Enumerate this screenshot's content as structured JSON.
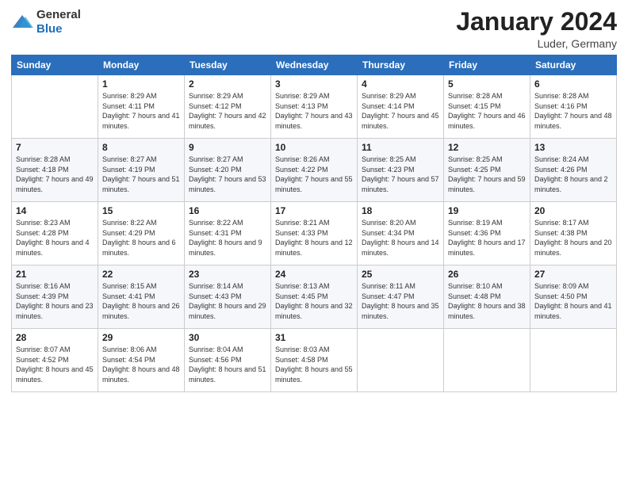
{
  "header": {
    "logo": {
      "text_general": "General",
      "text_blue": "Blue"
    },
    "title": "January 2024",
    "location": "Luder, Germany"
  },
  "days_of_week": [
    "Sunday",
    "Monday",
    "Tuesday",
    "Wednesday",
    "Thursday",
    "Friday",
    "Saturday"
  ],
  "weeks": [
    [
      {
        "day": null
      },
      {
        "day": 1,
        "sunrise": "Sunrise: 8:29 AM",
        "sunset": "Sunset: 4:11 PM",
        "daylight": "Daylight: 7 hours and 41 minutes."
      },
      {
        "day": 2,
        "sunrise": "Sunrise: 8:29 AM",
        "sunset": "Sunset: 4:12 PM",
        "daylight": "Daylight: 7 hours and 42 minutes."
      },
      {
        "day": 3,
        "sunrise": "Sunrise: 8:29 AM",
        "sunset": "Sunset: 4:13 PM",
        "daylight": "Daylight: 7 hours and 43 minutes."
      },
      {
        "day": 4,
        "sunrise": "Sunrise: 8:29 AM",
        "sunset": "Sunset: 4:14 PM",
        "daylight": "Daylight: 7 hours and 45 minutes."
      },
      {
        "day": 5,
        "sunrise": "Sunrise: 8:28 AM",
        "sunset": "Sunset: 4:15 PM",
        "daylight": "Daylight: 7 hours and 46 minutes."
      },
      {
        "day": 6,
        "sunrise": "Sunrise: 8:28 AM",
        "sunset": "Sunset: 4:16 PM",
        "daylight": "Daylight: 7 hours and 48 minutes."
      }
    ],
    [
      {
        "day": 7,
        "sunrise": "Sunrise: 8:28 AM",
        "sunset": "Sunset: 4:18 PM",
        "daylight": "Daylight: 7 hours and 49 minutes."
      },
      {
        "day": 8,
        "sunrise": "Sunrise: 8:27 AM",
        "sunset": "Sunset: 4:19 PM",
        "daylight": "Daylight: 7 hours and 51 minutes."
      },
      {
        "day": 9,
        "sunrise": "Sunrise: 8:27 AM",
        "sunset": "Sunset: 4:20 PM",
        "daylight": "Daylight: 7 hours and 53 minutes."
      },
      {
        "day": 10,
        "sunrise": "Sunrise: 8:26 AM",
        "sunset": "Sunset: 4:22 PM",
        "daylight": "Daylight: 7 hours and 55 minutes."
      },
      {
        "day": 11,
        "sunrise": "Sunrise: 8:25 AM",
        "sunset": "Sunset: 4:23 PM",
        "daylight": "Daylight: 7 hours and 57 minutes."
      },
      {
        "day": 12,
        "sunrise": "Sunrise: 8:25 AM",
        "sunset": "Sunset: 4:25 PM",
        "daylight": "Daylight: 7 hours and 59 minutes."
      },
      {
        "day": 13,
        "sunrise": "Sunrise: 8:24 AM",
        "sunset": "Sunset: 4:26 PM",
        "daylight": "Daylight: 8 hours and 2 minutes."
      }
    ],
    [
      {
        "day": 14,
        "sunrise": "Sunrise: 8:23 AM",
        "sunset": "Sunset: 4:28 PM",
        "daylight": "Daylight: 8 hours and 4 minutes."
      },
      {
        "day": 15,
        "sunrise": "Sunrise: 8:22 AM",
        "sunset": "Sunset: 4:29 PM",
        "daylight": "Daylight: 8 hours and 6 minutes."
      },
      {
        "day": 16,
        "sunrise": "Sunrise: 8:22 AM",
        "sunset": "Sunset: 4:31 PM",
        "daylight": "Daylight: 8 hours and 9 minutes."
      },
      {
        "day": 17,
        "sunrise": "Sunrise: 8:21 AM",
        "sunset": "Sunset: 4:33 PM",
        "daylight": "Daylight: 8 hours and 12 minutes."
      },
      {
        "day": 18,
        "sunrise": "Sunrise: 8:20 AM",
        "sunset": "Sunset: 4:34 PM",
        "daylight": "Daylight: 8 hours and 14 minutes."
      },
      {
        "day": 19,
        "sunrise": "Sunrise: 8:19 AM",
        "sunset": "Sunset: 4:36 PM",
        "daylight": "Daylight: 8 hours and 17 minutes."
      },
      {
        "day": 20,
        "sunrise": "Sunrise: 8:17 AM",
        "sunset": "Sunset: 4:38 PM",
        "daylight": "Daylight: 8 hours and 20 minutes."
      }
    ],
    [
      {
        "day": 21,
        "sunrise": "Sunrise: 8:16 AM",
        "sunset": "Sunset: 4:39 PM",
        "daylight": "Daylight: 8 hours and 23 minutes."
      },
      {
        "day": 22,
        "sunrise": "Sunrise: 8:15 AM",
        "sunset": "Sunset: 4:41 PM",
        "daylight": "Daylight: 8 hours and 26 minutes."
      },
      {
        "day": 23,
        "sunrise": "Sunrise: 8:14 AM",
        "sunset": "Sunset: 4:43 PM",
        "daylight": "Daylight: 8 hours and 29 minutes."
      },
      {
        "day": 24,
        "sunrise": "Sunrise: 8:13 AM",
        "sunset": "Sunset: 4:45 PM",
        "daylight": "Daylight: 8 hours and 32 minutes."
      },
      {
        "day": 25,
        "sunrise": "Sunrise: 8:11 AM",
        "sunset": "Sunset: 4:47 PM",
        "daylight": "Daylight: 8 hours and 35 minutes."
      },
      {
        "day": 26,
        "sunrise": "Sunrise: 8:10 AM",
        "sunset": "Sunset: 4:48 PM",
        "daylight": "Daylight: 8 hours and 38 minutes."
      },
      {
        "day": 27,
        "sunrise": "Sunrise: 8:09 AM",
        "sunset": "Sunset: 4:50 PM",
        "daylight": "Daylight: 8 hours and 41 minutes."
      }
    ],
    [
      {
        "day": 28,
        "sunrise": "Sunrise: 8:07 AM",
        "sunset": "Sunset: 4:52 PM",
        "daylight": "Daylight: 8 hours and 45 minutes."
      },
      {
        "day": 29,
        "sunrise": "Sunrise: 8:06 AM",
        "sunset": "Sunset: 4:54 PM",
        "daylight": "Daylight: 8 hours and 48 minutes."
      },
      {
        "day": 30,
        "sunrise": "Sunrise: 8:04 AM",
        "sunset": "Sunset: 4:56 PM",
        "daylight": "Daylight: 8 hours and 51 minutes."
      },
      {
        "day": 31,
        "sunrise": "Sunrise: 8:03 AM",
        "sunset": "Sunset: 4:58 PM",
        "daylight": "Daylight: 8 hours and 55 minutes."
      },
      {
        "day": null
      },
      {
        "day": null
      },
      {
        "day": null
      }
    ]
  ]
}
